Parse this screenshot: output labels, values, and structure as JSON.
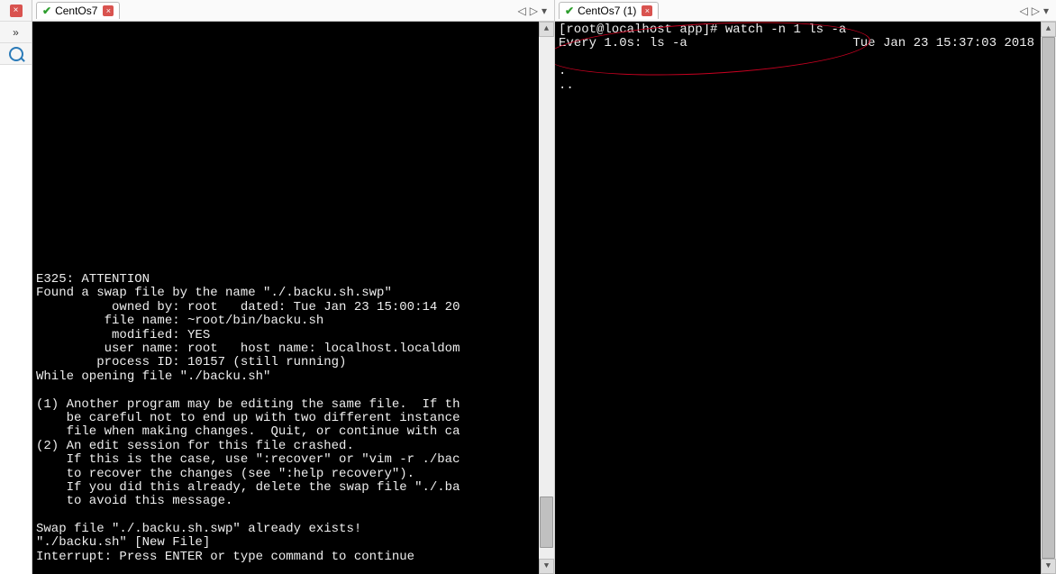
{
  "leftSidebar": {
    "close": "×",
    "chevrons": "»"
  },
  "tabs": {
    "left": {
      "label": "CentOs7"
    },
    "right": {
      "label": "CentOs7 (1)"
    },
    "navPrev": "◁",
    "navNext": "▷",
    "navMenu": "▾"
  },
  "termLeft": {
    "blank_top": "\n\n\n\n\n\n\n\n\n\n\n\n\n\n\n\n\n",
    "l01": "E325: ATTENTION",
    "l02": "Found a swap file by the name \"./.backu.sh.swp\"",
    "l03": "          owned by: root   dated: Tue Jan 23 15:00:14 20",
    "l04": "         file name: ~root/bin/backu.sh",
    "l05": "          modified: YES",
    "l06": "         user name: root   host name: localhost.localdom",
    "l07": "        process ID: 10157 (still running)",
    "l08": "While opening file \"./backu.sh\"",
    "l09": "",
    "l10": "(1) Another program may be editing the same file.  If th",
    "l11": "    be careful not to end up with two different instance",
    "l12": "    file when making changes.  Quit, or continue with ca",
    "l13": "(2) An edit session for this file crashed.",
    "l14": "    If this is the case, use \":recover\" or \"vim -r ./bac",
    "l15": "    to recover the changes (see \":help recovery\").",
    "l16": "    If you did this already, delete the swap file \"./.ba",
    "l17": "    to avoid this message.",
    "l18": "",
    "l19": "Swap file \"./.backu.sh.swp\" already exists!",
    "l20": "\"./backu.sh\" [New File]",
    "l21": "Interrupt: Press ENTER or type command to continue"
  },
  "termRight": {
    "prompt": "[root@localhost app]# watch -n 1 ls -a",
    "watch_left": "Every 1.0s: ls -a",
    "watch_right": "Tue Jan 23 15:37:03 2018",
    "blank": "",
    "dot": ".",
    "dotdot": ".."
  }
}
